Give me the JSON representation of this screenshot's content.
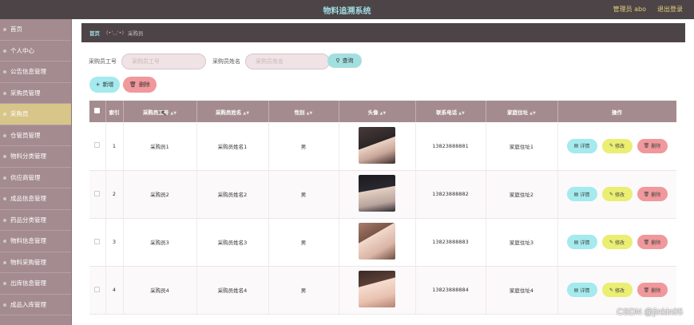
{
  "header": {
    "title": "物料追溯系统",
    "admin": "管理员 abo",
    "logout": "退出登录"
  },
  "sidebar": {
    "items": [
      {
        "label": "首页"
      },
      {
        "label": "个人中心"
      },
      {
        "label": "公告信息管理"
      },
      {
        "label": "采购员管理"
      },
      {
        "label": "采购员",
        "active": true
      },
      {
        "label": "仓管员管理"
      },
      {
        "label": "物料分类管理"
      },
      {
        "label": "供应商管理"
      },
      {
        "label": "成品信息管理"
      },
      {
        "label": "药品分类管理"
      },
      {
        "label": "物料信息管理"
      },
      {
        "label": "物料采购管理"
      },
      {
        "label": "出库信息管理"
      },
      {
        "label": "成品入库管理"
      }
    ]
  },
  "breadcrumb": {
    "home": "首页",
    "face": "(•'◡'•)",
    "current": "采购员"
  },
  "search": {
    "id_label": "采购员工号",
    "id_placeholder": "采购员工号",
    "name_label": "采购员姓名",
    "name_placeholder": "采购员姓名",
    "button": "查询"
  },
  "actions": {
    "add": "新增",
    "delete": "删除"
  },
  "table": {
    "columns": [
      "索引",
      "采购员工号",
      "采购员姓名",
      "性别",
      "头像",
      "联系电话",
      "家庭住址",
      "操作"
    ],
    "rows": [
      {
        "index": "1",
        "id": "采购员1",
        "name": "采购员姓名1",
        "gender": "男",
        "phone": "13823888881",
        "address": "家庭住址1",
        "avatar": "av1"
      },
      {
        "index": "2",
        "id": "采购员2",
        "name": "采购员姓名2",
        "gender": "男",
        "phone": "13823888882",
        "address": "家庭住址2",
        "avatar": "av2"
      },
      {
        "index": "3",
        "id": "采购员3",
        "name": "采购员姓名3",
        "gender": "男",
        "phone": "13823888883",
        "address": "家庭住址3",
        "avatar": "av3"
      },
      {
        "index": "4",
        "id": "采购员4",
        "name": "采购员姓名4",
        "gender": "男",
        "phone": "13823888884",
        "address": "家庭住址4",
        "avatar": "av4"
      }
    ],
    "op_detail": "详情",
    "op_edit": "修改",
    "op_delete": "删除"
  },
  "watermark": "CSDN @jinkin05"
}
